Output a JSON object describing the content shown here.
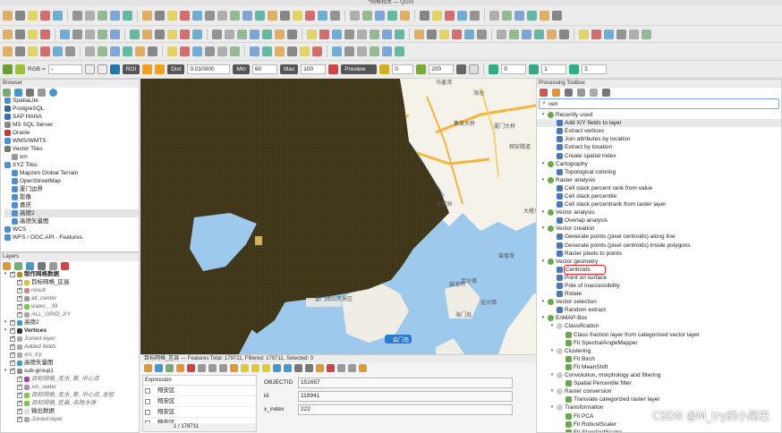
{
  "window": {
    "title": "*网格相关 — QGIS"
  },
  "toolbar3": {
    "band": "RGB =",
    "roi": "ROI",
    "dist_label": "Dist",
    "dist_value": "0.010000",
    "min_label": "Min",
    "min_value": "60",
    "max_label": "Max",
    "max_value": "100",
    "preview": "Preview",
    "v1": "0",
    "v2": "200",
    "v3": "0",
    "v4": "1",
    "v5": "2"
  },
  "browser": {
    "title": "Browser",
    "items": [
      {
        "label": "SpatiaLite",
        "color": "#4a90d9"
      },
      {
        "label": "PostgreSQL",
        "color": "#336699"
      },
      {
        "label": "SAP HANA",
        "color": "#2a6fc0"
      },
      {
        "label": "MS SQL Server",
        "color": "#888"
      },
      {
        "label": "Oracle",
        "color": "#c33"
      },
      {
        "label": "WMS/WMTS",
        "color": "#4a90d9"
      },
      {
        "label": "Vector Tiles",
        "color": "#777"
      },
      {
        "label": "xm",
        "color": "#999"
      },
      {
        "label": "XYZ Tiles",
        "color": "#4a90d9"
      },
      {
        "label": "Mapzen Global Terrain",
        "color": "#4a90d9"
      },
      {
        "label": "OpenStreetMap",
        "color": "#4a90d9"
      },
      {
        "label": "厦门边界",
        "color": "#4a90d9"
      },
      {
        "label": "影像",
        "color": "#4a90d9"
      },
      {
        "label": "喜庆",
        "color": "#4a90d9"
      },
      {
        "label": "高德2",
        "color": "#4a90d9"
      },
      {
        "label": "高德矢量图",
        "color": "#4a90d9"
      },
      {
        "label": "WCS",
        "color": "#4a90d9"
      },
      {
        "label": "WFS / OGC API - Features",
        "color": "#4a90d9"
      }
    ]
  },
  "layers": {
    "title": "Layers",
    "items": [
      {
        "label": "制作网格数据",
        "bold": true
      },
      {
        "label": "目标网格_区县"
      },
      {
        "label": "result",
        "italic": true
      },
      {
        "label": "all_center",
        "italic": true
      },
      {
        "label": "water__fill",
        "italic": true
      },
      {
        "label": "ALL_GRID_XY",
        "italic": true
      },
      {
        "label": "高德2"
      },
      {
        "label": "Vertices",
        "bold": true
      },
      {
        "label": "Joined layer",
        "italic": true
      },
      {
        "label": "Added fields",
        "italic": true
      },
      {
        "label": "xm_try",
        "italic": true
      },
      {
        "label": "高德矢量图"
      },
      {
        "label": "sub-group1"
      },
      {
        "label": "目标网格_无水_新_中心点",
        "italic": true
      },
      {
        "label": "xm_water",
        "italic": true
      },
      {
        "label": "目标网格_无水_新_中心点_坐标",
        "italic": true
      },
      {
        "label": "目标网格_区县_去除水体",
        "italic": true
      },
      {
        "label": "输出数据"
      },
      {
        "label": "Joined layer",
        "italic": true
      }
    ]
  },
  "map": {
    "labels": [
      "马銮湾",
      "厦门大桥",
      "集美大桥",
      "翔安隧道",
      "海沧",
      "鼓浪屿",
      "会门岛",
      "金沙镇",
      "海门岛",
      "白鹭洲",
      "厦门南山风景区",
      "金沙镇",
      "大嶝岛",
      "曾厝垵"
    ]
  },
  "attribute_table": {
    "title": "目标网格_区县 — Features Total: 179711, Filtered: 179711, Selected: 0",
    "expression_label": "Expression",
    "rows": [
      "翔安区",
      "翔安区",
      "翔安区",
      "翔安区"
    ],
    "fields": [
      {
        "name": "OBJECTID",
        "value": "151657"
      },
      {
        "name": "id",
        "value": "119941"
      },
      {
        "name": "x_index",
        "value": "222"
      }
    ],
    "page": "1 / 179711"
  },
  "processing": {
    "title": "Processing Toolbox",
    "search": "cen",
    "tree": [
      {
        "label": "Recently used",
        "level": 0,
        "type": "group"
      },
      {
        "label": "Add X/Y fields to layer",
        "level": 1,
        "type": "alg",
        "selected": true
      },
      {
        "label": "Extract vertices",
        "level": 1,
        "type": "alg"
      },
      {
        "label": "Join attributes by location",
        "level": 1,
        "type": "alg"
      },
      {
        "label": "Extract by location",
        "level": 1,
        "type": "alg"
      },
      {
        "label": "Create spatial index",
        "level": 1,
        "type": "alg"
      },
      {
        "label": "Cartography",
        "level": 0,
        "type": "group"
      },
      {
        "label": "Topological coloring",
        "level": 1,
        "type": "alg"
      },
      {
        "label": "Raster analysis",
        "level": 0,
        "type": "group"
      },
      {
        "label": "Cell stack percent rank from value",
        "level": 1,
        "type": "alg"
      },
      {
        "label": "Cell stack percentile",
        "level": 1,
        "type": "alg"
      },
      {
        "label": "Cell stack percentrank from raster layer",
        "level": 1,
        "type": "alg"
      },
      {
        "label": "Vector analysis",
        "level": 0,
        "type": "group"
      },
      {
        "label": "Overlap analysis",
        "level": 1,
        "type": "alg"
      },
      {
        "label": "Vector creation",
        "level": 0,
        "type": "group"
      },
      {
        "label": "Generate points (pixel centroids) along line",
        "level": 1,
        "type": "alg"
      },
      {
        "label": "Generate points (pixel centroids) inside polygons",
        "level": 1,
        "type": "alg"
      },
      {
        "label": "Raster pixels to points",
        "level": 1,
        "type": "alg"
      },
      {
        "label": "Vector geometry",
        "level": 0,
        "type": "group"
      },
      {
        "label": "Centroids",
        "level": 1,
        "type": "alg",
        "highlight": true
      },
      {
        "label": "Point on surface",
        "level": 1,
        "type": "alg"
      },
      {
        "label": "Pole of inaccessibility",
        "level": 1,
        "type": "alg"
      },
      {
        "label": "Rotate",
        "level": 1,
        "type": "alg"
      },
      {
        "label": "Vector selection",
        "level": 0,
        "type": "group"
      },
      {
        "label": "Random extract",
        "level": 1,
        "type": "alg"
      },
      {
        "label": "EnMAP-Box",
        "level": 0,
        "type": "group"
      },
      {
        "label": "Classification",
        "level": 1,
        "type": "group"
      },
      {
        "label": "Class fraction layer from categorized vector layer",
        "level": 2,
        "type": "alg"
      },
      {
        "label": "Fit SpectralAngleMapper",
        "level": 2,
        "type": "alg"
      },
      {
        "label": "Clustering",
        "level": 1,
        "type": "group"
      },
      {
        "label": "Fit Birch",
        "level": 2,
        "type": "alg"
      },
      {
        "label": "Fit MeanShift",
        "level": 2,
        "type": "alg"
      },
      {
        "label": "Convolution, morphology and filtering",
        "level": 1,
        "type": "group"
      },
      {
        "label": "Spatial Percentile filter",
        "level": 2,
        "type": "alg"
      },
      {
        "label": "Raster conversion",
        "level": 1,
        "type": "group"
      },
      {
        "label": "Translate categorized raster layer",
        "level": 2,
        "type": "alg"
      },
      {
        "label": "Transformation",
        "level": 1,
        "type": "group"
      },
      {
        "label": "Fit PCA",
        "level": 2,
        "type": "alg"
      },
      {
        "label": "Fit RobustScaler",
        "level": 2,
        "type": "alg"
      },
      {
        "label": "Fit StandardScaler",
        "level": 2,
        "type": "alg"
      }
    ]
  },
  "watermark": "CSDN @M_try的小尾巴"
}
